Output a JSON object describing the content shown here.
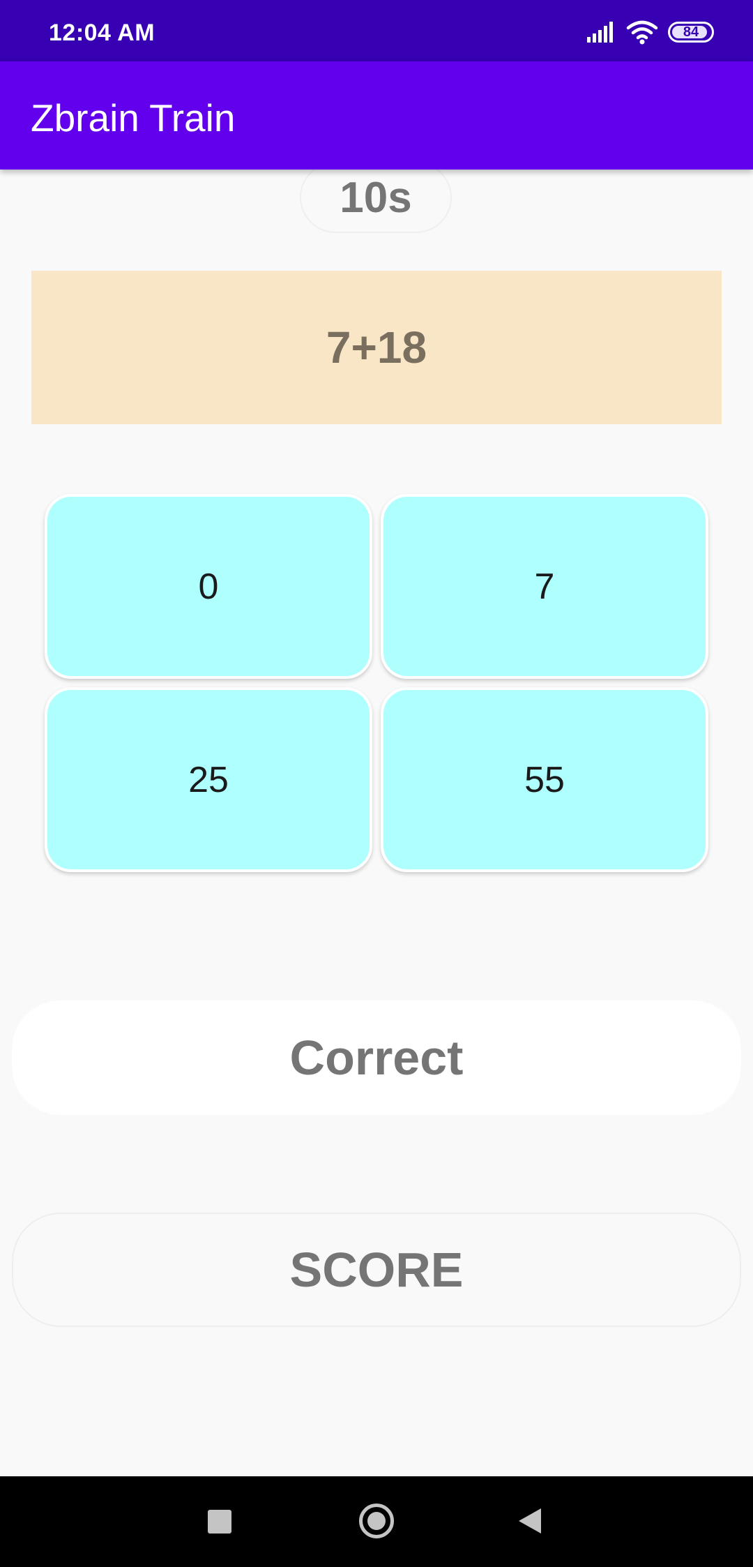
{
  "status_bar": {
    "time": "12:04 AM",
    "battery": "84",
    "icons": [
      "signal-icon",
      "wifi-icon",
      "battery-icon"
    ]
  },
  "app_bar": {
    "title": "Zbrain Train"
  },
  "game": {
    "timer": "10s",
    "question": "7+18",
    "answers": [
      "0",
      "7",
      "25",
      "55"
    ],
    "result": "Correct",
    "score_label": "SCORE"
  },
  "colors": {
    "status_bar": "#3700b3",
    "app_bar": "#6200ee",
    "question_bg": "#f8e6c6",
    "answer_bg": "#afffff"
  },
  "nav_bar": {
    "icons": [
      "recents-icon",
      "home-icon",
      "back-icon"
    ]
  }
}
